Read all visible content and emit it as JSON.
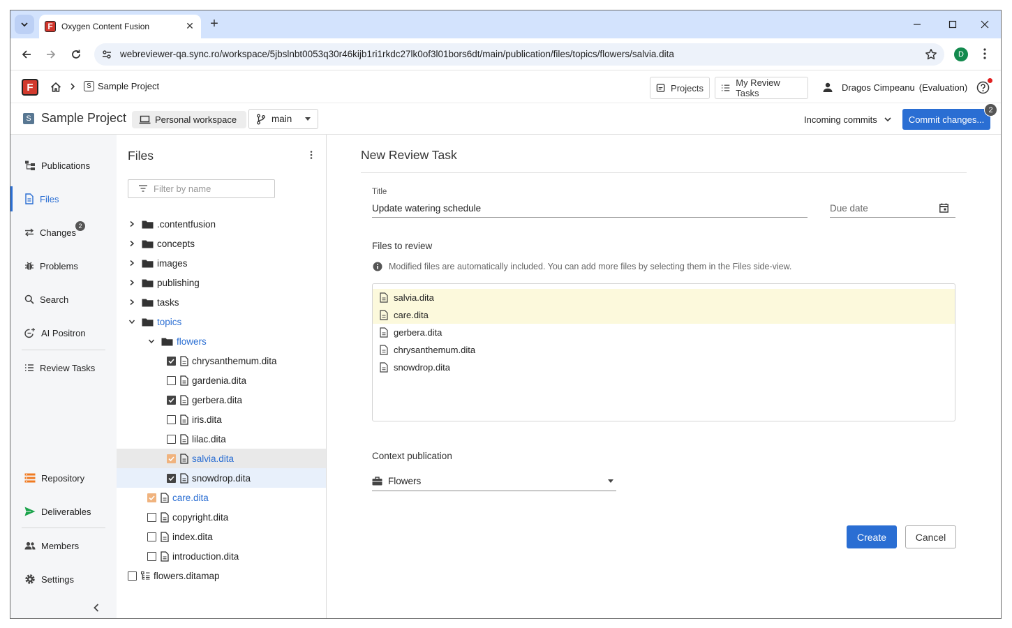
{
  "browser": {
    "tab_title": "Oxygen Content Fusion",
    "tab_close": "✕",
    "new_tab": "+",
    "favicon_letter": "F",
    "url": "webreviewer-qa.sync.ro/workspace/5jbslnbt0053q30r46kijb1ri1rkdc27lk0of3l01bors6dt/main/publication/files/topics/flowers/salvia.dita",
    "profile_initial": "D"
  },
  "header": {
    "logo_letter": "F",
    "breadcrumb_project_letter": "S",
    "breadcrumb_project": "Sample Project",
    "projects_button": "Projects",
    "review_tasks_button": "My Review Tasks",
    "user_name": "Dragos Cimpeanu",
    "user_plan": "(Evaluation)"
  },
  "project_bar": {
    "badge_letter": "S",
    "project_name": "Sample Project",
    "workspace": "Personal workspace",
    "branch": "main",
    "incoming_commits": "Incoming commits",
    "commit_button": "Commit changes...",
    "commit_count": "2"
  },
  "left_nav": {
    "items": [
      {
        "label": "Publications",
        "icon": "publications-icon"
      },
      {
        "label": "Files",
        "icon": "file-icon",
        "active": true
      },
      {
        "label": "Changes",
        "icon": "changes-icon",
        "badge": "2"
      },
      {
        "label": "Problems",
        "icon": "bug-icon"
      },
      {
        "label": "Search",
        "icon": "search-icon"
      },
      {
        "label": "AI Positron",
        "icon": "ai-positron-icon"
      },
      {
        "label": "Review Tasks",
        "icon": "list-icon"
      },
      {
        "label": "Repository",
        "icon": "repository-icon"
      },
      {
        "label": "Deliverables",
        "icon": "send-icon"
      },
      {
        "label": "Members",
        "icon": "members-icon"
      },
      {
        "label": "Settings",
        "icon": "gear-icon"
      }
    ]
  },
  "files_panel": {
    "title": "Files",
    "filter_placeholder": "Filter by name",
    "tree": [
      {
        "label": ".contentfusion",
        "type": "folder",
        "expanded": false
      },
      {
        "label": "concepts",
        "type": "folder",
        "expanded": false
      },
      {
        "label": "images",
        "type": "folder",
        "expanded": false
      },
      {
        "label": "publishing",
        "type": "folder",
        "expanded": false
      },
      {
        "label": "tasks",
        "type": "folder",
        "expanded": false
      },
      {
        "label": "topics",
        "type": "folder",
        "expanded": true
      },
      {
        "label": "flowers",
        "type": "folder",
        "expanded": true
      },
      {
        "label": "chrysanthemum.dita",
        "type": "file",
        "check": "checked"
      },
      {
        "label": "gardenia.dita",
        "type": "file",
        "check": "unchecked"
      },
      {
        "label": "gerbera.dita",
        "type": "file",
        "check": "checked"
      },
      {
        "label": "iris.dita",
        "type": "file",
        "check": "unchecked"
      },
      {
        "label": "lilac.dita",
        "type": "file",
        "check": "unchecked"
      },
      {
        "label": "salvia.dita",
        "type": "file",
        "check": "modified"
      },
      {
        "label": "snowdrop.dita",
        "type": "file",
        "check": "checked"
      },
      {
        "label": "care.dita",
        "type": "file",
        "check": "modified"
      },
      {
        "label": "copyright.dita",
        "type": "file",
        "check": "unchecked"
      },
      {
        "label": "index.dita",
        "type": "file",
        "check": "unchecked"
      },
      {
        "label": "introduction.dita",
        "type": "file",
        "check": "unchecked"
      },
      {
        "label": "flowers.ditamap",
        "type": "map",
        "check": "unchecked"
      }
    ]
  },
  "review_form": {
    "heading": "New Review Task",
    "title_label": "Title",
    "title_value": "Update watering schedule",
    "due_date_placeholder": "Due date",
    "files_to_review_label": "Files to review",
    "info_text": "Modified files are automatically included. You can add more files by selecting them in the Files side-view.",
    "files": [
      {
        "name": "salvia.dita",
        "highlighted": true
      },
      {
        "name": "care.dita",
        "highlighted": true
      },
      {
        "name": "gerbera.dita",
        "highlighted": false
      },
      {
        "name": "chrysanthemum.dita",
        "highlighted": false
      },
      {
        "name": "snowdrop.dita",
        "highlighted": false
      }
    ],
    "context_label": "Context publication",
    "context_value": "Flowers",
    "create_button": "Create",
    "cancel_button": "Cancel"
  },
  "colors": {
    "accent": "#2a6ed3",
    "tabstrip": "#d3e3fd",
    "modified_check": "#f0b37e",
    "highlight_row": "#fcf9dc"
  }
}
